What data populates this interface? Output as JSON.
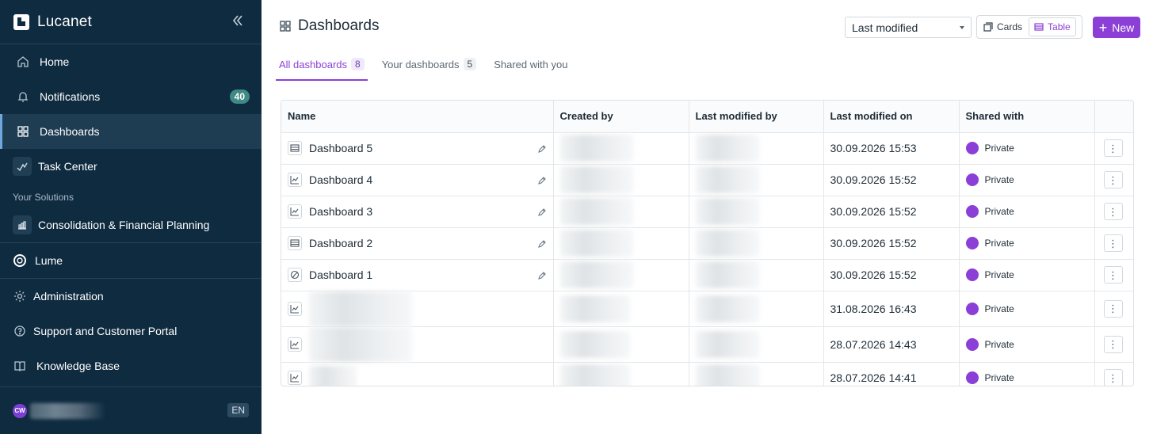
{
  "brand": {
    "name": "Lucanet"
  },
  "sidebar": {
    "items": [
      {
        "label": "Home",
        "icon": "home-icon"
      },
      {
        "label": "Notifications",
        "icon": "bell-icon",
        "badge": "40"
      },
      {
        "label": "Dashboards",
        "icon": "grid-icon",
        "active": true
      },
      {
        "label": "Task Center",
        "icon": "check-trend-icon"
      }
    ],
    "section_title": "Your Solutions",
    "solutions": [
      {
        "label": "Consolidation & Financial Planning",
        "icon": "chart-icon"
      }
    ],
    "lume": {
      "label": "Lume",
      "icon": "ring-icon"
    },
    "bottom_items": [
      {
        "label": "Administration",
        "icon": "gear-icon"
      },
      {
        "label": "Support and Customer Portal",
        "icon": "help-circle-icon"
      },
      {
        "label": "Knowledge Base",
        "icon": "book-icon"
      }
    ],
    "user": {
      "initials": "CW",
      "language": "EN"
    }
  },
  "header": {
    "title": "Dashboards",
    "sort": {
      "selected": "Last modified"
    },
    "view": {
      "cards_label": "Cards",
      "table_label": "Table",
      "active": "Table"
    },
    "new_label": "New"
  },
  "tabs": [
    {
      "label": "All dashboards",
      "count": "8",
      "active": true
    },
    {
      "label": "Your dashboards",
      "count": "5"
    },
    {
      "label": "Shared with you",
      "count": ""
    }
  ],
  "table": {
    "columns": [
      "Name",
      "Created by",
      "Last modified by",
      "Last modified on",
      "Shared with"
    ],
    "rows": [
      {
        "name": "Dashboard 5",
        "icon": "table-icon",
        "modified_on": "30.09.2026 15:53",
        "shared": "Private"
      },
      {
        "name": "Dashboard 4",
        "icon": "line-chart-icon",
        "modified_on": "30.09.2026 15:52",
        "shared": "Private"
      },
      {
        "name": "Dashboard 3",
        "icon": "line-chart-icon",
        "modified_on": "30.09.2026 15:52",
        "shared": "Private"
      },
      {
        "name": "Dashboard 2",
        "icon": "table-icon",
        "modified_on": "30.09.2026 15:52",
        "shared": "Private"
      },
      {
        "name": "Dashboard 1",
        "icon": "pie-icon",
        "modified_on": "30.09.2026 15:52",
        "shared": "Private"
      },
      {
        "name": "",
        "icon": "line-chart-icon",
        "modified_on": "31.08.2026 16:43",
        "shared": "Private"
      },
      {
        "name": "",
        "icon": "line-chart-icon",
        "modified_on": "28.07.2026 14:43",
        "shared": "Private"
      },
      {
        "name": "",
        "icon": "line-chart-icon",
        "modified_on": "28.07.2026 14:41",
        "shared": "Private"
      }
    ]
  },
  "colors": {
    "sidebar_bg": "#0f2b40",
    "accent": "#8b3fd6",
    "badge": "#3f8a85"
  }
}
